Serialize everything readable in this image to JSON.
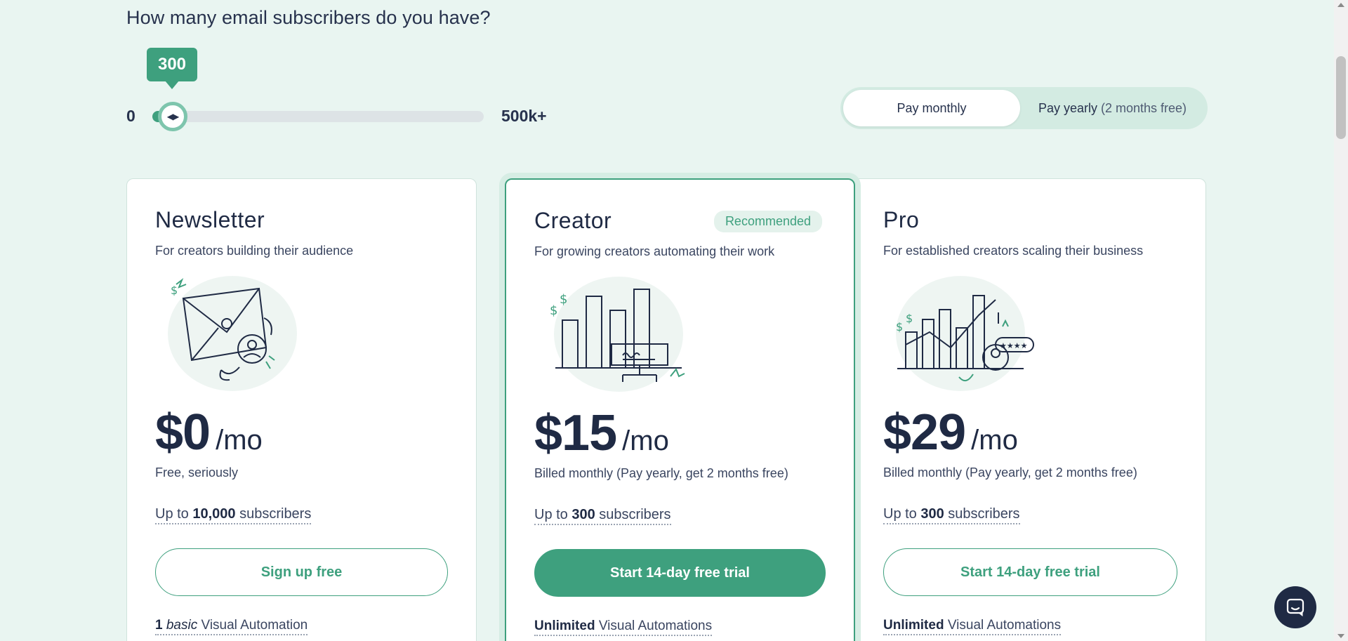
{
  "question": "How many email subscribers do you have?",
  "slider": {
    "value_label": "300",
    "min_label": "0",
    "max_label": "500k+",
    "fraction": 0.012
  },
  "billing_toggle": {
    "monthly": "Pay monthly",
    "yearly": "Pay yearly",
    "yearly_note": "(2 months free)"
  },
  "plans": [
    {
      "name": "Newsletter",
      "desc": "For creators building their audience",
      "price": "$0",
      "per": "/mo",
      "note": "Free, seriously",
      "subs_prefix": "Up to ",
      "subs_count": "10,000",
      "subs_suffix": " subscribers",
      "cta": "Sign up free",
      "feature_bold": "1",
      "feature_italic": "basic",
      "feature_rest": "Visual Automation"
    },
    {
      "name": "Creator",
      "badge": "Recommended",
      "desc": "For growing creators automating their work",
      "price": "$15",
      "per": "/mo",
      "note": "Billed monthly (Pay yearly, get 2 months free)",
      "subs_prefix": "Up to ",
      "subs_count": "300",
      "subs_suffix": " subscribers",
      "cta": "Start 14-day free trial",
      "feature_bold": "Unlimited",
      "feature_rest": "Visual Automations"
    },
    {
      "name": "Pro",
      "desc": "For established creators scaling their business",
      "price": "$29",
      "per": "/mo",
      "note": "Billed monthly (Pay yearly, get 2 months free)",
      "subs_prefix": "Up to ",
      "subs_count": "300",
      "subs_suffix": " subscribers",
      "cta": "Start 14-day free trial",
      "feature_bold": "Unlimited",
      "feature_rest": "Visual Automations"
    }
  ],
  "colors": {
    "accent": "#3ea07e",
    "navy": "#1f2a44",
    "background": "#e9f5f1"
  },
  "icons": {
    "chat": "chat-bubble-icon",
    "slider_thumb": "arrows-left-right-icon"
  }
}
